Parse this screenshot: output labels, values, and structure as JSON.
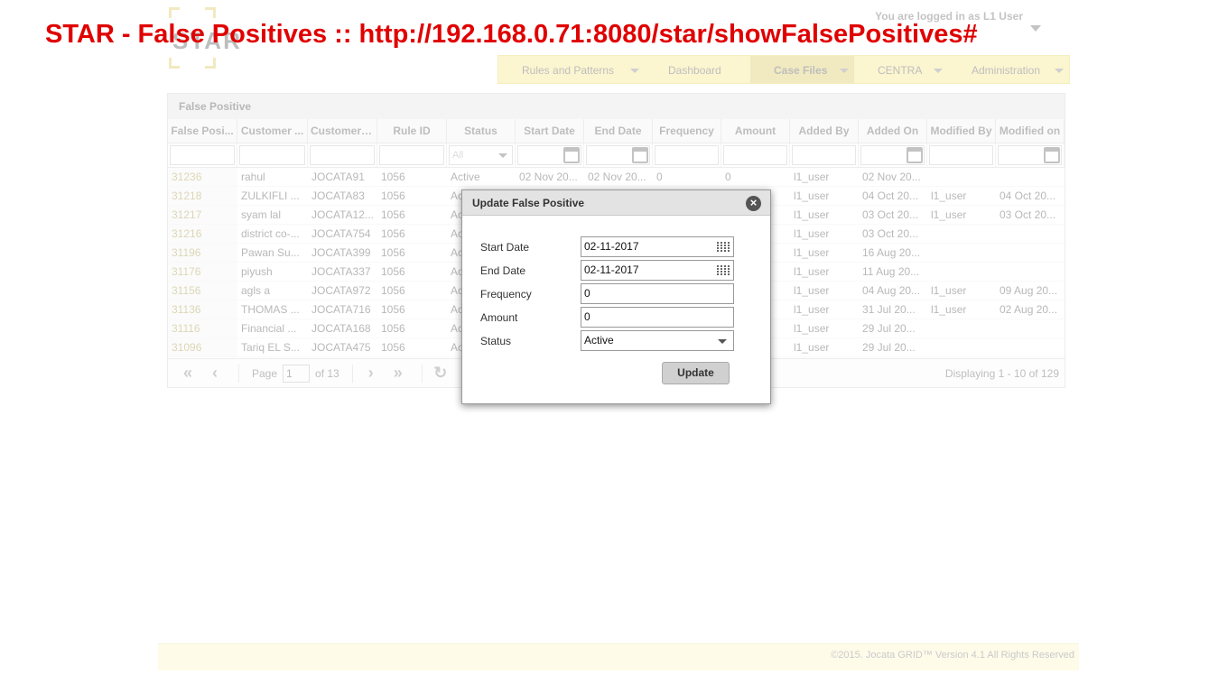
{
  "page_title": "STAR - False Positives :: http://192.168.0.71:8080/star/showFalsePositives#",
  "header": {
    "logo_text": "STAR",
    "logged_in_text": "You are logged in as L1 User",
    "user_sub": " "
  },
  "nav": [
    {
      "label": "Rules and Patterns"
    },
    {
      "label": "Dashboard"
    },
    {
      "label": "Case Files"
    },
    {
      "label": "CENTRA"
    },
    {
      "label": "Administration"
    }
  ],
  "grid": {
    "title": "False Positive",
    "columns": [
      "False Posi...",
      "Customer ...",
      "Customer ID",
      "Rule ID",
      "Status",
      "Start Date",
      "End Date",
      "Frequency",
      "Amount",
      "Added By",
      "Added On",
      "Modified By",
      "Modified on"
    ],
    "status_filter": "All",
    "rows": [
      [
        "31236",
        "rahul",
        "JOCATA91",
        "1056",
        "Active",
        "02 Nov 20...",
        "02 Nov 20...",
        "0",
        "0",
        "l1_user",
        "02 Nov 20...",
        "",
        ""
      ],
      [
        "31218",
        "ZULKIFLI ...",
        "JOCATA83",
        "1056",
        "Ac",
        "",
        "",
        "",
        "",
        "l1_user",
        "04 Oct 20...",
        "l1_user",
        "04 Oct 20..."
      ],
      [
        "31217",
        "syam lal",
        "JOCATA12...",
        "1056",
        "Ac",
        "",
        "",
        "",
        "",
        "l1_user",
        "03 Oct 20...",
        "l1_user",
        "03 Oct 20..."
      ],
      [
        "31216",
        "district co-...",
        "JOCATA754",
        "1056",
        "Ac",
        "",
        "",
        "",
        "",
        "l1_user",
        "03 Oct 20...",
        "",
        ""
      ],
      [
        "31196",
        "Pawan Su...",
        "JOCATA399",
        "1056",
        "Ac",
        "",
        "",
        "",
        "",
        "l1_user",
        "16 Aug 20...",
        "",
        ""
      ],
      [
        "31176",
        "piyush",
        "JOCATA337",
        "1056",
        "Ac",
        "",
        "",
        "",
        "",
        "l1_user",
        "11 Aug 20...",
        "",
        ""
      ],
      [
        "31156",
        "agls a",
        "JOCATA972",
        "1056",
        "Ac",
        "",
        "",
        "",
        "",
        "l1_user",
        "04 Aug 20...",
        "l1_user",
        "09 Aug 20..."
      ],
      [
        "31136",
        "THOMAS ...",
        "JOCATA716",
        "1056",
        "Ac",
        "",
        "",
        "",
        "",
        "l1_user",
        "31 Jul 20...",
        "l1_user",
        "02 Aug 20..."
      ],
      [
        "31116",
        "Financial ...",
        "JOCATA168",
        "1056",
        "Ac",
        "",
        "",
        "",
        "",
        "l1_user",
        "29 Jul 20...",
        "",
        ""
      ],
      [
        "31096",
        "Tariq EL S...",
        "JOCATA475",
        "1056",
        "Ac",
        "",
        "",
        "",
        "",
        "l1_user",
        "29 Jul 20...",
        "",
        ""
      ]
    ],
    "pager": {
      "page_label": "Page",
      "page_value": "1",
      "of_label": "of 13",
      "refresh_label": "R",
      "displaying": "Displaying 1 - 10 of 129"
    }
  },
  "footer": "©2015. Jocata GRID™ Version 4.1 All Rights Reserved",
  "modal": {
    "title": "Update False Positive",
    "fields": {
      "start_date_label": "Start Date",
      "start_date_value": "02-11-2017",
      "end_date_label": "End Date",
      "end_date_value": "02-11-2017",
      "frequency_label": "Frequency",
      "frequency_value": "0",
      "amount_label": "Amount",
      "amount_value": "0",
      "status_label": "Status",
      "status_value": "Active"
    },
    "update_label": "Update",
    "close_glyph": "×"
  }
}
